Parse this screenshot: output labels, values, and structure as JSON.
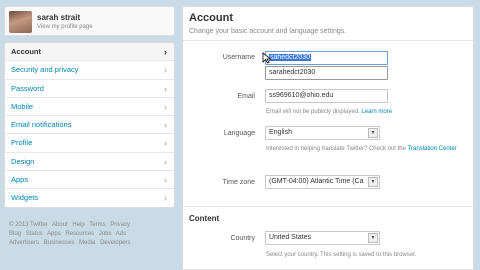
{
  "profile": {
    "name": "sarah strait",
    "view_link": "View my profile page"
  },
  "nav": {
    "items": [
      {
        "label": "Account",
        "active": true
      },
      {
        "label": "Security and privacy"
      },
      {
        "label": "Password"
      },
      {
        "label": "Mobile"
      },
      {
        "label": "Email notifications"
      },
      {
        "label": "Profile"
      },
      {
        "label": "Design"
      },
      {
        "label": "Apps"
      },
      {
        "label": "Widgets"
      }
    ],
    "chevron": "›"
  },
  "footer": {
    "line1": [
      "© 2013 Twitter",
      "About",
      "Help",
      "Terms",
      "Privacy"
    ],
    "line2": [
      "Blog",
      "Status",
      "Apps",
      "Resources",
      "Jobs",
      "Ads"
    ],
    "line3": [
      "Advertisers",
      "Businesses",
      "Media",
      "Developers"
    ]
  },
  "account": {
    "title": "Account",
    "subtitle": "Change your basic account and language settings.",
    "username_label": "Username",
    "username_value": "sahedct2030",
    "username_suggestion": "sarahedct2030",
    "email_label": "Email",
    "email_value": "ss969610@ohio.edu",
    "email_hint": "Email will not be publicly displayed.",
    "email_hint_link": "Learn more",
    "language_label": "Language",
    "language_value": "English",
    "language_hint": "Interested in helping translate Twitter? Check out the",
    "language_hint_link": "Translation Center",
    "timezone_label": "Time zone",
    "timezone_value": "(GMT-04:00) Atlantic Time (Ca"
  },
  "content": {
    "title": "Content",
    "country_label": "Country",
    "country_value": "United States",
    "country_hint": "Select your country. This setting is saved to this browser."
  },
  "colors": {
    "accent": "#0084b4",
    "background": "#c9dbe6",
    "selection": "#3875d7"
  }
}
